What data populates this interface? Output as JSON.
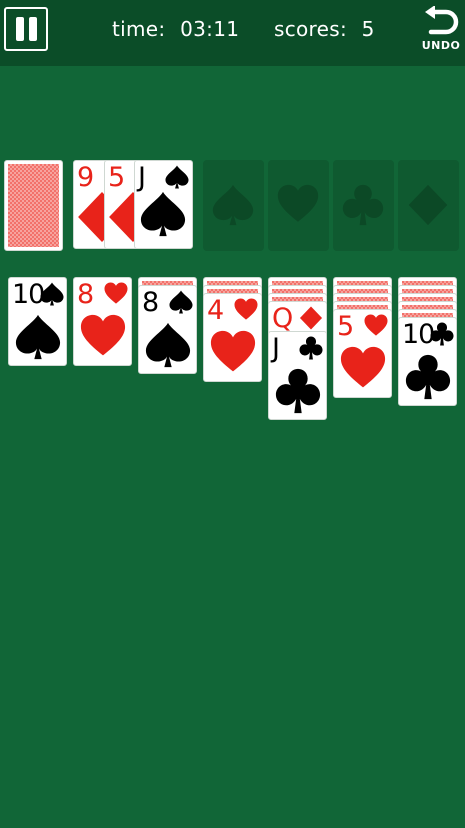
{
  "hud": {
    "time_label": "time:",
    "time_value": "03:11",
    "score_label": "scores:",
    "score_value": "5",
    "undo_label": "UNDO"
  },
  "colors": {
    "felt": "#116637",
    "bar": "#0b4d28",
    "red_suit": "#e8231a",
    "foundation": "#0f5a30"
  },
  "stock": {
    "face_down": true
  },
  "waste": [
    {
      "rank": "9",
      "suit": "diamonds"
    },
    {
      "rank": "5",
      "suit": "diamonds"
    },
    {
      "rank": "J",
      "suit": "spades"
    }
  ],
  "foundations": [
    {
      "suit": "spades",
      "icon": "spade-icon"
    },
    {
      "suit": "hearts",
      "icon": "heart-icon"
    },
    {
      "suit": "clubs",
      "icon": "club-icon"
    },
    {
      "suit": "diamonds",
      "icon": "diamond-icon"
    }
  ],
  "tableau": [
    {
      "face_down": 0,
      "face_up": [
        {
          "rank": "10",
          "suit": "spades"
        }
      ]
    },
    {
      "face_down": 0,
      "face_up": [
        {
          "rank": "8",
          "suit": "hearts"
        }
      ]
    },
    {
      "face_down": 1,
      "face_up": [
        {
          "rank": "8",
          "suit": "spades"
        }
      ]
    },
    {
      "face_down": 2,
      "face_up": [
        {
          "rank": "4",
          "suit": "hearts"
        }
      ]
    },
    {
      "face_down": 3,
      "face_up": [
        {
          "rank": "Q",
          "suit": "diamonds"
        },
        {
          "rank": "J",
          "suit": "clubs"
        }
      ]
    },
    {
      "face_down": 4,
      "face_up": [
        {
          "rank": "5",
          "suit": "hearts"
        }
      ]
    },
    {
      "face_down": 5,
      "face_up": [
        {
          "rank": "10",
          "suit": "clubs"
        }
      ]
    }
  ]
}
